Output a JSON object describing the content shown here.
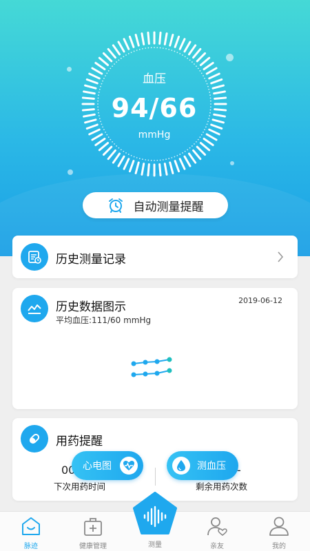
{
  "gauge": {
    "title": "血压",
    "value": "94/66",
    "unit": "mmHg"
  },
  "auto_reminder": {
    "label": "自动测量提醒",
    "icon": "alarm-clock-icon"
  },
  "history": {
    "title": "历史测量记录",
    "icon": "record-icon"
  },
  "chart_card": {
    "title": "历史数据图示",
    "date": "2019-06-12",
    "average": "平均血压:111/60 mmHg",
    "icon": "trend-icon"
  },
  "medication": {
    "title": "用药提醒",
    "next_value": "00",
    "next_label": "下次用药时间",
    "remaining_value": "-",
    "remaining_label": "剩余用药次数",
    "icon": "pill-icon"
  },
  "floating": {
    "ecg": "心电图",
    "bp": "测血压"
  },
  "tabs": [
    {
      "label": "脉迹",
      "icon": "home-icon",
      "active": true
    },
    {
      "label": "健康管理",
      "icon": "medical-kit-icon",
      "active": false
    },
    {
      "label": "测量",
      "icon": "measure-icon",
      "active": false
    },
    {
      "label": "亲友",
      "icon": "friends-icon",
      "active": false
    },
    {
      "label": "我的",
      "icon": "profile-icon",
      "active": false
    }
  ],
  "colors": {
    "accent": "#1fa8ee",
    "hero_top": "#45d9d6",
    "hero_bottom": "#1a9fe6"
  }
}
